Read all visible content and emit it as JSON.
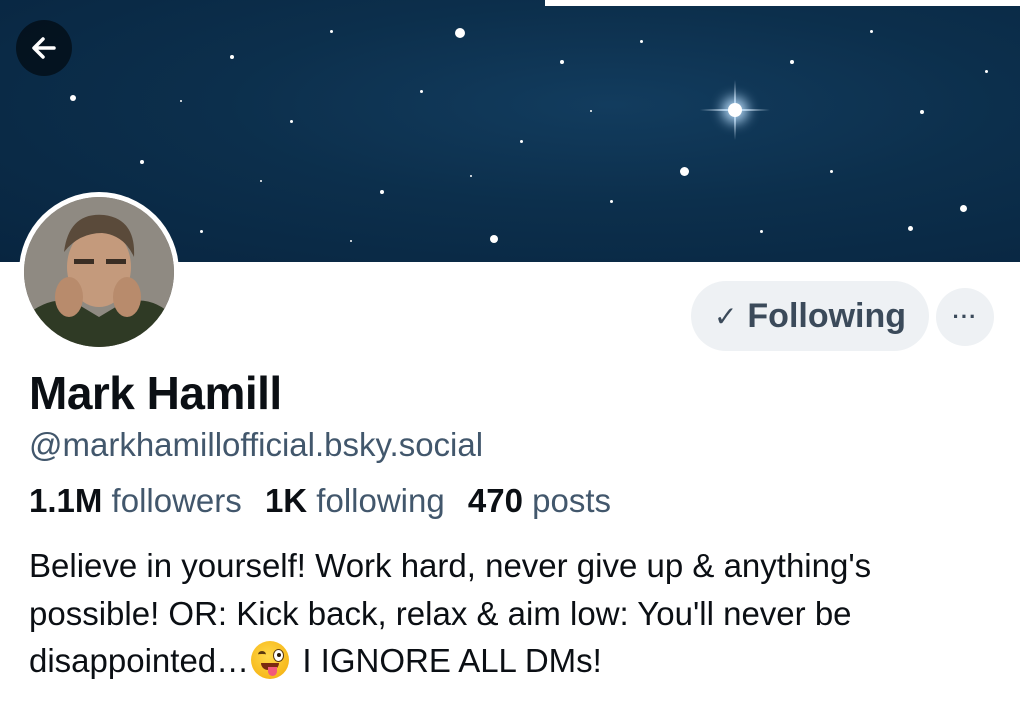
{
  "profile": {
    "display_name": "Mark Hamill",
    "handle": "@markhamillofficial.bsky.social",
    "stats": {
      "followers_count": "1.1M",
      "followers_label": "followers",
      "following_count": "1K",
      "following_label": "following",
      "posts_count": "470",
      "posts_label": "posts"
    },
    "bio_part1": "Believe in yourself! Work hard, never give up & anything's possible! OR: Kick back, relax & aim low: You'll never be disappointed…",
    "bio_emoji": "winking-face-with-tongue",
    "bio_part2": " I IGNORE ALL DMs!"
  },
  "actions": {
    "following_label": "Following",
    "following_icon": "check-icon",
    "more_label": "···"
  },
  "nav": {
    "back_icon": "arrow-left-icon"
  },
  "colors": {
    "banner": "#0c2f4c",
    "pill_bg": "#eef1f4",
    "secondary_text": "#42576c",
    "primary_text": "#0b0f14"
  }
}
